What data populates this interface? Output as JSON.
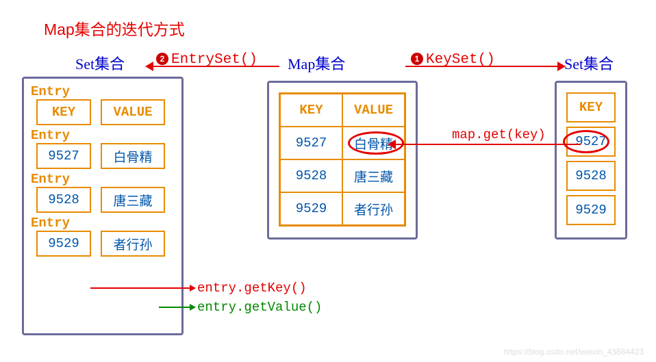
{
  "title": "Map集合的迭代方式",
  "labels": {
    "set_left": "Set集合",
    "map_mid": "Map集合",
    "set_right": "Set集合",
    "entryset": "EntrySet()",
    "keyset": "KeySet()",
    "badge1": "1",
    "badge2": "2",
    "mapget": "map.get(key)",
    "getkey": "entry.getKey()",
    "getvalue": "entry.getValue()",
    "entry": "Entry",
    "key": "KEY",
    "value": "VALUE"
  },
  "entries": [
    {
      "key": "9527",
      "value": "白骨精"
    },
    {
      "key": "9528",
      "value": "唐三藏"
    },
    {
      "key": "9529",
      "value": "者行孙"
    }
  ],
  "watermark": "https://blog.csdn.net/weixin_43884423"
}
